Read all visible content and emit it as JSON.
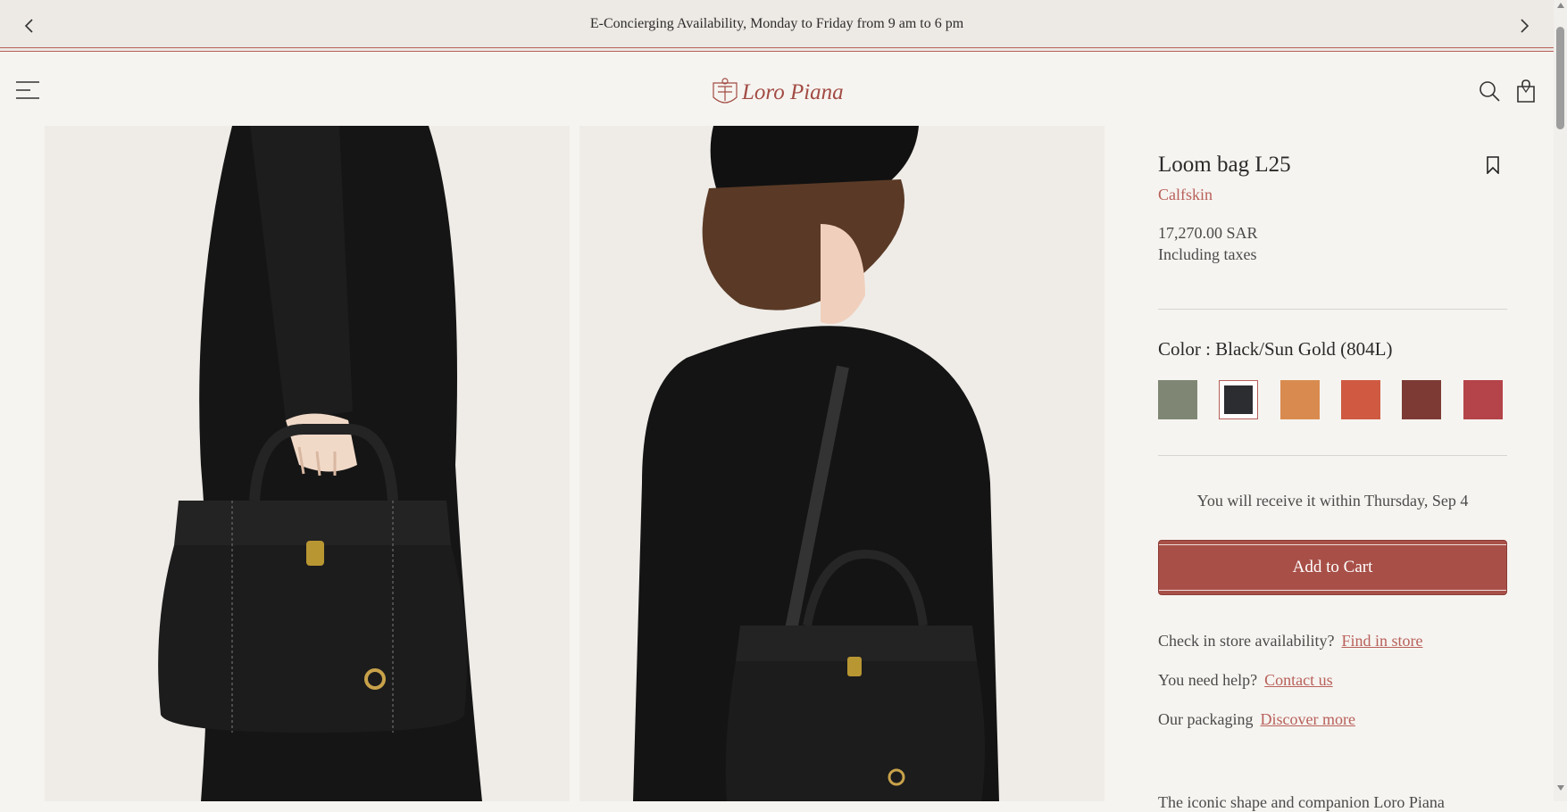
{
  "promo": {
    "text": "E-Concierging Availability, Monday to Friday from 9 am to 6 pm",
    "prev_icon": "chevron-left-icon",
    "next_icon": "chevron-right-icon"
  },
  "header": {
    "logo_text": "Loro Piana",
    "menu_icon": "menu-icon",
    "search_icon": "search-icon",
    "bag_icon": "shopping-bag-icon"
  },
  "product": {
    "title": "Loom bag L25",
    "material": "Calfskin",
    "price": "17,270.00 SAR",
    "tax_note": "Including taxes",
    "color_label": "Color : Black/Sun Gold (804L)",
    "swatches": [
      {
        "name": "sage-green",
        "color": "#7f8774"
      },
      {
        "name": "black-sun-gold",
        "color": "#2b2d31",
        "selected": true
      },
      {
        "name": "orange-tan",
        "color": "#d98b4f"
      },
      {
        "name": "terracotta",
        "color": "#cf5a41"
      },
      {
        "name": "burgundy-brown",
        "color": "#7d3a34"
      },
      {
        "name": "red",
        "color": "#b5434a"
      }
    ],
    "delivery_text": "You will receive it within Thursday, Sep 4",
    "add_to_cart": "Add to Cart",
    "store_check_label": "Check in store availability?",
    "store_check_link": "Find in store",
    "help_label": "You need help?",
    "help_link": "Contact us",
    "packaging_label": "Our packaging",
    "packaging_link": "Discover more",
    "bottom_partial": "The iconic shape and companion Loro Piana"
  },
  "colors": {
    "accent": "#b8605a",
    "button": "#a85048",
    "background": "#f6f4f0"
  }
}
